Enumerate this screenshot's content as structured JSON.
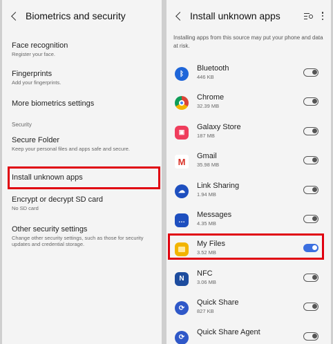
{
  "left_panel": {
    "title": "Biometrics and security",
    "items": [
      {
        "title": "Face recognition",
        "subtitle": "Register your face."
      },
      {
        "title": "Fingerprints",
        "subtitle": "Add your fingerprints."
      },
      {
        "title": "More biometrics settings",
        "subtitle": ""
      },
      {
        "title": "Secure Folder",
        "subtitle": "Keep your personal files and apps safe and secure."
      },
      {
        "title": "Install unknown apps",
        "subtitle": ""
      },
      {
        "title": "Encrypt or decrypt SD card",
        "subtitle": "No SD card"
      },
      {
        "title": "Other security settings",
        "subtitle": "Change other security settings, such as those for security updates and credential storage."
      }
    ],
    "section_label": "Security"
  },
  "right_panel": {
    "title": "Install unknown apps",
    "description": "Installing apps from this source may put your phone and data at risk.",
    "apps": [
      {
        "name": "Bluetooth",
        "size": "446 KB",
        "enabled": false,
        "icon": "bluetooth-icon",
        "color": "#1f66d9"
      },
      {
        "name": "Chrome",
        "size": "32.39 MB",
        "enabled": false,
        "icon": "chrome-icon",
        "color": "#db4437"
      },
      {
        "name": "Galaxy Store",
        "size": "187 MB",
        "enabled": false,
        "icon": "galaxy-store-icon",
        "color": "#ef3d5c"
      },
      {
        "name": "Gmail",
        "size": "35.98 MB",
        "enabled": false,
        "icon": "gmail-icon",
        "color": "#ffffff"
      },
      {
        "name": "Link Sharing",
        "size": "1.94 MB",
        "enabled": false,
        "icon": "link-sharing-icon",
        "color": "#1e4fbf"
      },
      {
        "name": "Messages",
        "size": "4.35 MB",
        "enabled": false,
        "icon": "messages-icon",
        "color": "#1e4fbf"
      },
      {
        "name": "My Files",
        "size": "3.52 MB",
        "enabled": true,
        "icon": "my-files-icon",
        "color": "#f2b400"
      },
      {
        "name": "NFC",
        "size": "3.06 MB",
        "enabled": false,
        "icon": "nfc-icon",
        "color": "#1d4c9e"
      },
      {
        "name": "Quick Share",
        "size": "827 KB",
        "enabled": false,
        "icon": "quick-share-icon",
        "color": "#2f58c8"
      },
      {
        "name": "Quick Share Agent",
        "size": "",
        "enabled": false,
        "icon": "quick-share-agent-icon",
        "color": "#2f58c8"
      }
    ]
  },
  "colors": {
    "highlight": "#e0000f",
    "toggle_on": "#3b6fe0"
  }
}
